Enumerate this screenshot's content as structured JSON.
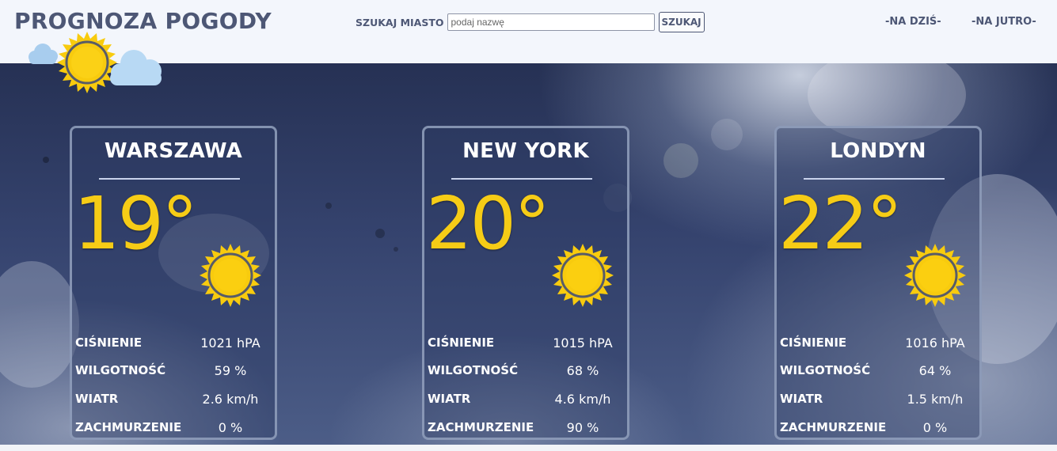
{
  "header": {
    "title": "PROGNOZA POGODY",
    "logo_icon": "sun-with-clouds-icon",
    "search_label": "SZUKAJ MIASTO",
    "search_placeholder": "podaj nazwę",
    "search_value": "",
    "search_button": "SZUKAJ",
    "nav": [
      "-NA DZIŚ-",
      "-NA JUTRO-"
    ]
  },
  "cities": [
    {
      "name": "WARSZAWA",
      "temperature": "19°",
      "icon": "sun-icon",
      "stats": [
        {
          "label": "CIŚNIENIE",
          "value": "1021 hPA"
        },
        {
          "label": "WILGOTNOŚĆ",
          "value": "59 %"
        },
        {
          "label": "WIATR",
          "value": "2.6 km/h"
        },
        {
          "label": "ZACHMURZENIE",
          "value": "0 %"
        }
      ]
    },
    {
      "name": "NEW YORK",
      "temperature": "20°",
      "icon": "sun-icon",
      "stats": [
        {
          "label": "CIŚNIENIE",
          "value": "1015 hPA"
        },
        {
          "label": "WILGOTNOŚĆ",
          "value": "68 %"
        },
        {
          "label": "WIATR",
          "value": "4.6 km/h"
        },
        {
          "label": "ZACHMURZENIE",
          "value": "90 %"
        }
      ]
    },
    {
      "name": "LONDYN",
      "temperature": "22°",
      "icon": "sun-icon",
      "stats": [
        {
          "label": "CIŚNIENIE",
          "value": "1016 hPA"
        },
        {
          "label": "WILGOTNOŚĆ",
          "value": "64 %"
        },
        {
          "label": "WIATR",
          "value": "1.5 km/h"
        },
        {
          "label": "ZACHMURZENIE",
          "value": "0 %"
        }
      ]
    }
  ],
  "colors": {
    "header_bg": "#f3f6fc",
    "header_text": "#4d5775",
    "temperature": "#f6cc16",
    "sun": "#f8cb0e",
    "sun_outline": "#585c68",
    "card_border": "#94a2be",
    "card_underline": "#c9d3ec"
  }
}
